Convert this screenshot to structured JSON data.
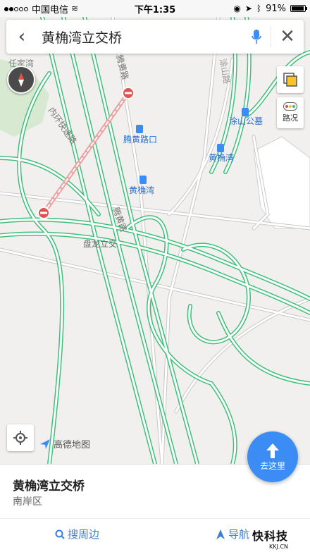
{
  "statusbar": {
    "carrier": "中国电信",
    "time": "下午1:35",
    "battery": "91%"
  },
  "search": {
    "query": "黄桷湾立交桥"
  },
  "map": {
    "labels": {
      "road_top": "腾黄路",
      "ring_road": "内环快速路",
      "station1": "腾黄路口",
      "station2": "黄桷湾",
      "station3": "黄桷湾",
      "bus_top": "涂山公墓",
      "interchange": "盘龙立交",
      "left_top": "任家湾",
      "right_road": "涂山路",
      "road_mid": "腾黄路"
    },
    "traffic_label": "路况",
    "brand": "高德地图",
    "goto_label": "去这里"
  },
  "panel": {
    "title": "黄桷湾立交桥",
    "district": "南岸区",
    "search_nearby": "搜周边",
    "navigate": "导航",
    "watermark_main": "快科技",
    "watermark_sub": "KKJ.CN"
  },
  "colors": {
    "road_green": "#3ec07a",
    "accent_blue": "#3b8cf5",
    "closure_red": "#e0524f"
  }
}
